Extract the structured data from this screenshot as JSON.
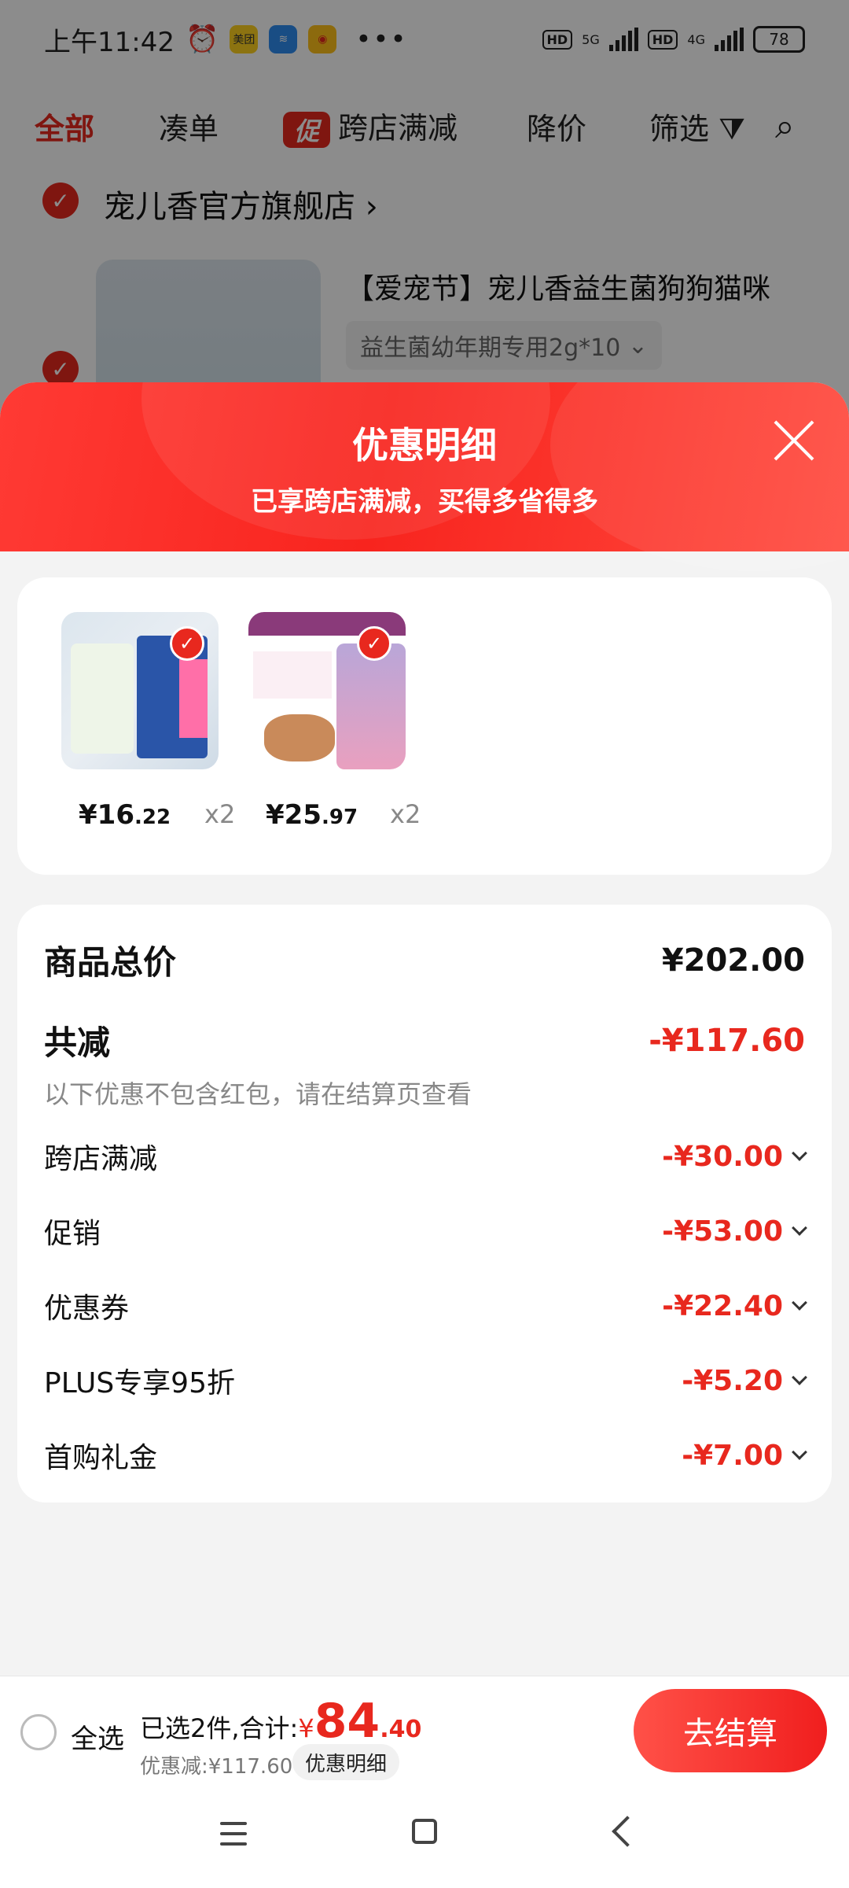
{
  "status_bar": {
    "time": "上午11:42",
    "apps": [
      "美团"
    ],
    "dots": "•••",
    "battery": "78",
    "net1": "5G",
    "net2": "4G",
    "hd": "HD"
  },
  "tabs": {
    "all": "全部",
    "bundle": "凑单",
    "promo_badge": "促",
    "cross_store": "跨店满减",
    "price_drop": "降价",
    "filter": "筛选"
  },
  "store": {
    "name": "宠儿香官方旗舰店",
    "product_title": "【爱宠节】宠儿香益生菌狗狗猫咪",
    "product_spec": "益生菌幼年期专用2g*10"
  },
  "sheet": {
    "title": "优惠明细",
    "subtitle": "已享跨店满减，买得多省得多"
  },
  "items": [
    {
      "price_int": "¥16",
      "price_dec": ".22",
      "qty": "x2"
    },
    {
      "price_int": "¥25",
      "price_dec": ".97",
      "qty": "x2"
    }
  ],
  "breakdown": {
    "total_label": "商品总价",
    "total_value": "¥202.00",
    "reduce_label": "共减",
    "reduce_value": "-¥117.60",
    "note": "以下优惠不包含红包，请在结算页查看",
    "rows": [
      {
        "label": "跨店满减",
        "value": "-¥30.00"
      },
      {
        "label": "促销",
        "value": "-¥53.00"
      },
      {
        "label": "优惠券",
        "value": "-¥22.40"
      },
      {
        "label": "PLUS专享95折",
        "value": "-¥5.20"
      },
      {
        "label": "首购礼金",
        "value": "-¥7.00"
      }
    ]
  },
  "bottom": {
    "select_all": "全选",
    "selected_text": "已选2件,合计:",
    "currency": "¥",
    "amount_int": "84",
    "amount_dec": ".40",
    "discount_text": "优惠减:¥117.60",
    "detail_chip": "优惠明细",
    "checkout": "去结算"
  },
  "colors": {
    "accent": "#e8281e",
    "header_gradient": "#ff3a34"
  }
}
